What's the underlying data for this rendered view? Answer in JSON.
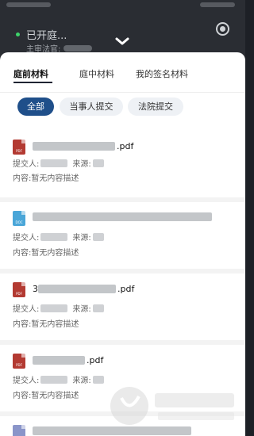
{
  "header": {
    "court_status": "已开庭...",
    "sub_label": "主审法官:",
    "collapse_icon": "chevron-down-icon",
    "record_icon": "record-icon"
  },
  "tabs": [
    {
      "label": "庭前材料",
      "active": true
    },
    {
      "label": "庭中材料",
      "active": false
    },
    {
      "label": "我的签名材料",
      "active": false
    }
  ],
  "filters": [
    {
      "label": "全部",
      "active": true
    },
    {
      "label": "当事人提交",
      "active": false
    },
    {
      "label": "法院提交",
      "active": false
    }
  ],
  "items": [
    {
      "type": "pdf",
      "icon_text": "PDF",
      "name_suffix": ".pdf",
      "submitter_label": "提交人:",
      "source_label": "来源:",
      "content": "内容:暂无内容描述"
    },
    {
      "type": "doc",
      "icon_text": "DOC",
      "name_suffix": "",
      "submitter_label": "提交人:",
      "source_label": "来源:",
      "content": "内容:暂无内容描述"
    },
    {
      "type": "pdf",
      "icon_text": "PDF",
      "name_prefix": "3",
      "name_suffix": ".pdf",
      "submitter_label": "提交人:",
      "source_label": "来源:",
      "content": "内容:暂无内容描述"
    },
    {
      "type": "pdf",
      "icon_text": "PDF",
      "name_suffix": ".pdf",
      "submitter_label": "提交人:",
      "source_label": "来源:",
      "content": "内容:暂无内容描述"
    }
  ],
  "colors": {
    "accent": "#1f4f8a",
    "pdf": "#b33a32",
    "doc": "#4aa6d8"
  }
}
